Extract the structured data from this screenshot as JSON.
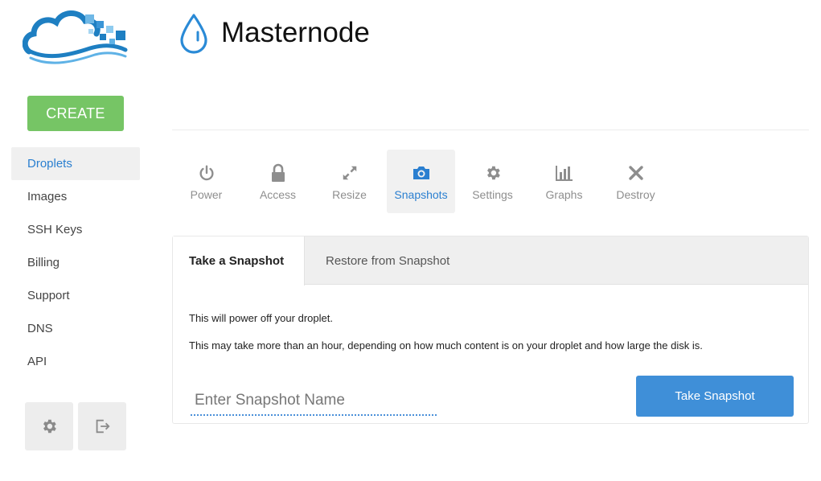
{
  "header": {
    "title": "Masternode"
  },
  "sidebar": {
    "create_label": "CREATE",
    "items": [
      {
        "label": "Droplets",
        "active": true
      },
      {
        "label": "Images"
      },
      {
        "label": "SSH Keys"
      },
      {
        "label": "Billing"
      },
      {
        "label": "Support"
      },
      {
        "label": "DNS"
      },
      {
        "label": "API"
      }
    ],
    "bottom_icons": [
      "gear-icon",
      "logout-icon"
    ]
  },
  "actions": [
    {
      "label": "Power",
      "icon": "power-icon"
    },
    {
      "label": "Access",
      "icon": "lock-icon"
    },
    {
      "label": "Resize",
      "icon": "resize-icon"
    },
    {
      "label": "Snapshots",
      "icon": "camera-icon",
      "active": true
    },
    {
      "label": "Settings",
      "icon": "gear-icon"
    },
    {
      "label": "Graphs",
      "icon": "graph-icon"
    },
    {
      "label": "Destroy",
      "icon": "close-icon"
    }
  ],
  "panel": {
    "tabs": [
      {
        "label": "Take a Snapshot",
        "active": true
      },
      {
        "label": "Restore from Snapshot"
      }
    ],
    "info_line1": "This will power off your droplet.",
    "info_line2": "This may take more than an hour, depending on how much content is on your droplet and how large the disk is.",
    "input_placeholder": "Enter Snapshot Name",
    "input_value": "",
    "button_label": "Take Snapshot"
  },
  "colors": {
    "accent": "#2a7fd0",
    "create_green": "#76c565",
    "button_blue": "#3f8fd8"
  }
}
